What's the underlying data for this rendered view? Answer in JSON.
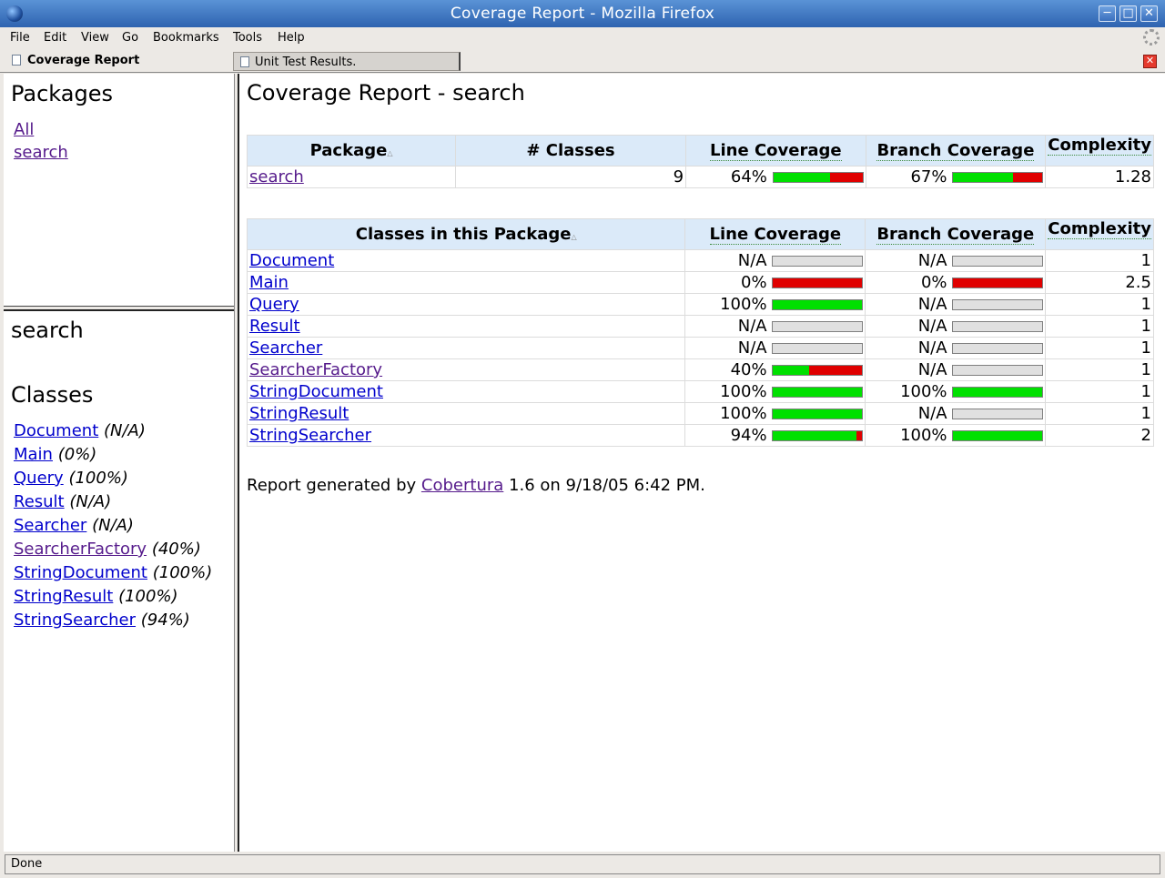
{
  "window": {
    "title": "Coverage Report - Mozilla Firefox"
  },
  "menu": [
    "File",
    "Edit",
    "View",
    "Go",
    "Bookmarks",
    "Tools",
    "Help"
  ],
  "tabs": {
    "left": "Coverage Report",
    "right": "Unit Test Results."
  },
  "packages_frame": {
    "heading": "Packages",
    "items": [
      "All",
      "search"
    ]
  },
  "classes_frame": {
    "package_name": "search",
    "heading": "Classes",
    "items": [
      {
        "name": "Document",
        "pct": "(N/A)",
        "visited": false
      },
      {
        "name": "Main",
        "pct": "(0%)",
        "visited": false
      },
      {
        "name": "Query",
        "pct": "(100%)",
        "visited": false
      },
      {
        "name": "Result",
        "pct": "(N/A)",
        "visited": false
      },
      {
        "name": "Searcher",
        "pct": "(N/A)",
        "visited": false
      },
      {
        "name": "SearcherFactory",
        "pct": "(40%)",
        "visited": true
      },
      {
        "name": "StringDocument",
        "pct": "(100%)",
        "visited": false
      },
      {
        "name": "StringResult",
        "pct": "(100%)",
        "visited": false
      },
      {
        "name": "StringSearcher",
        "pct": "(94%)",
        "visited": false
      }
    ]
  },
  "main": {
    "title": "Coverage Report - search",
    "package_table": {
      "headers": [
        "Package",
        "# Classes",
        "Line Coverage",
        "Branch Coverage",
        "Complexity"
      ],
      "row": {
        "name": "search",
        "classes": "9",
        "line": "64%",
        "line_frac": 0.64,
        "branch": "67%",
        "branch_frac": 0.67,
        "complexity": "1.28"
      }
    },
    "classes_table": {
      "headers": [
        "Classes in this Package",
        "Line Coverage",
        "Branch Coverage",
        "Complexity"
      ],
      "rows": [
        {
          "name": "Document",
          "line": "N/A",
          "line_frac": null,
          "branch": "N/A",
          "branch_frac": null,
          "complexity": "1",
          "visited": false
        },
        {
          "name": "Main",
          "line": "0%",
          "line_frac": 0,
          "branch": "0%",
          "branch_frac": 0,
          "complexity": "2.5",
          "visited": false
        },
        {
          "name": "Query",
          "line": "100%",
          "line_frac": 1,
          "branch": "N/A",
          "branch_frac": null,
          "complexity": "1",
          "visited": false
        },
        {
          "name": "Result",
          "line": "N/A",
          "line_frac": null,
          "branch": "N/A",
          "branch_frac": null,
          "complexity": "1",
          "visited": false
        },
        {
          "name": "Searcher",
          "line": "N/A",
          "line_frac": null,
          "branch": "N/A",
          "branch_frac": null,
          "complexity": "1",
          "visited": false
        },
        {
          "name": "SearcherFactory",
          "line": "40%",
          "line_frac": 0.4,
          "branch": "N/A",
          "branch_frac": null,
          "complexity": "1",
          "visited": true
        },
        {
          "name": "StringDocument",
          "line": "100%",
          "line_frac": 1,
          "branch": "100%",
          "branch_frac": 1,
          "complexity": "1",
          "visited": false
        },
        {
          "name": "StringResult",
          "line": "100%",
          "line_frac": 1,
          "branch": "N/A",
          "branch_frac": null,
          "complexity": "1",
          "visited": false
        },
        {
          "name": "StringSearcher",
          "line": "94%",
          "line_frac": 0.94,
          "branch": "100%",
          "branch_frac": 1,
          "complexity": "2",
          "visited": false
        }
      ]
    },
    "footer": {
      "prefix": "Report generated by",
      "link": "Cobertura",
      "suffix": "1.6 on 9/18/05 6:42 PM."
    }
  },
  "status": "Done",
  "colors": {
    "covered": "#00e000",
    "uncovered": "#e00000",
    "header_bg": "#dbeaf9"
  }
}
